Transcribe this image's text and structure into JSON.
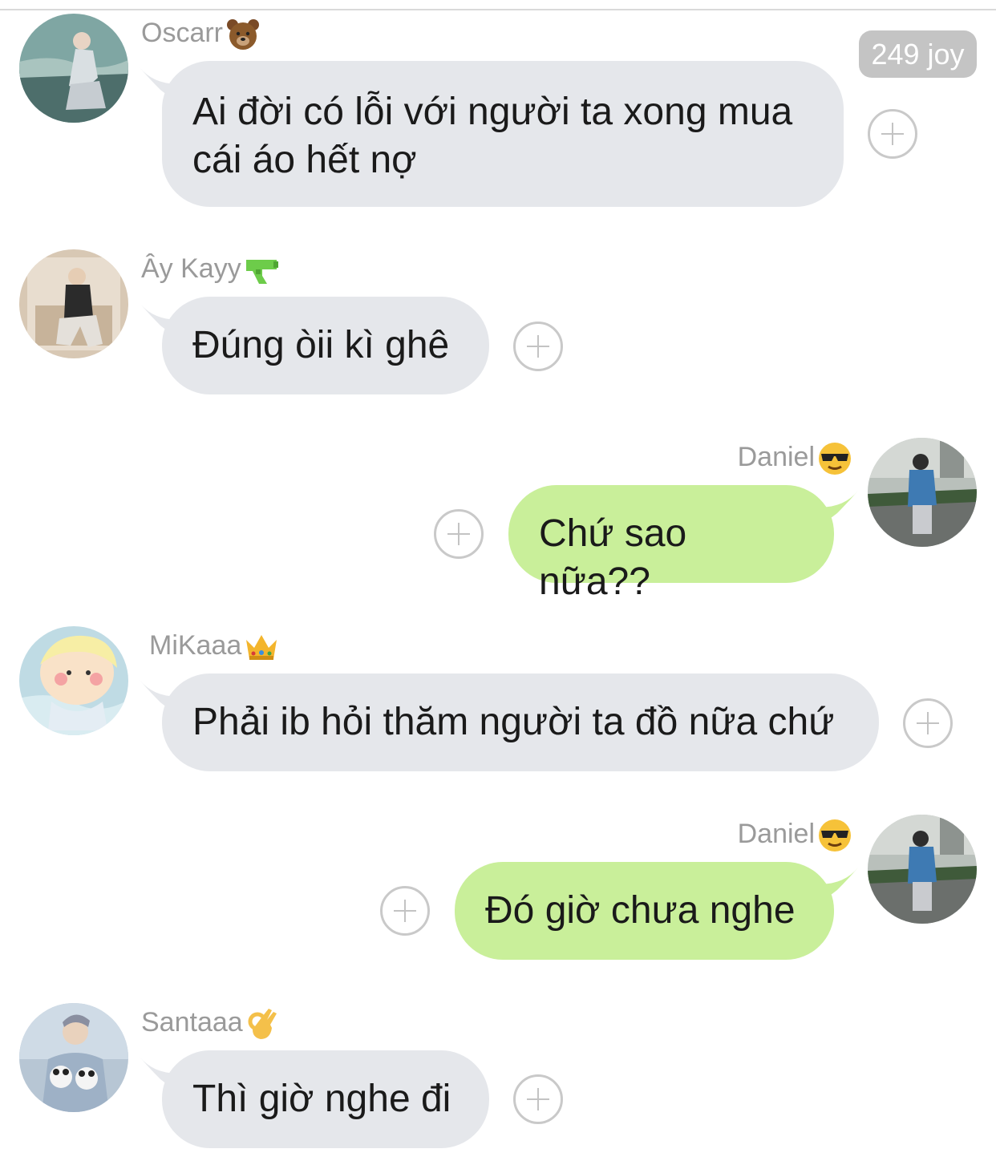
{
  "badge": {
    "text": "249 joy"
  },
  "messages": [
    {
      "sender": "Oscarr",
      "sender_emoji": "bear-emoji",
      "text": "Ai đời có lỗi với người ta xong mua cái áo hết nợ",
      "side": "incoming"
    },
    {
      "sender": "Ây Kayy",
      "sender_emoji": "water-pistol-emoji",
      "text": "Đúng òii kì ghê",
      "side": "incoming"
    },
    {
      "sender": "Daniel",
      "sender_emoji": "sunglasses-face-emoji",
      "text": "Chứ sao nữa??",
      "side": "outgoing"
    },
    {
      "sender": "MiKaaa",
      "sender_emoji": "crown-emoji",
      "text": "Phải ib hỏi thăm người ta đồ nữa chứ",
      "side": "incoming"
    },
    {
      "sender": "Daniel",
      "sender_emoji": "sunglasses-face-emoji",
      "text": "Đó giờ chưa nghe",
      "side": "outgoing"
    },
    {
      "sender": "Santaaa",
      "sender_emoji": "ok-hand-emoji",
      "text": "Thì giờ nghe đi",
      "side": "incoming"
    }
  ],
  "colors": {
    "incoming_bubble": "#e5e7eb",
    "outgoing_bubble": "#c9ef9a",
    "sender_name": "#9a9a9a",
    "badge_bg": "#c4c4c4",
    "plus_icon": "#c9c9c9"
  }
}
